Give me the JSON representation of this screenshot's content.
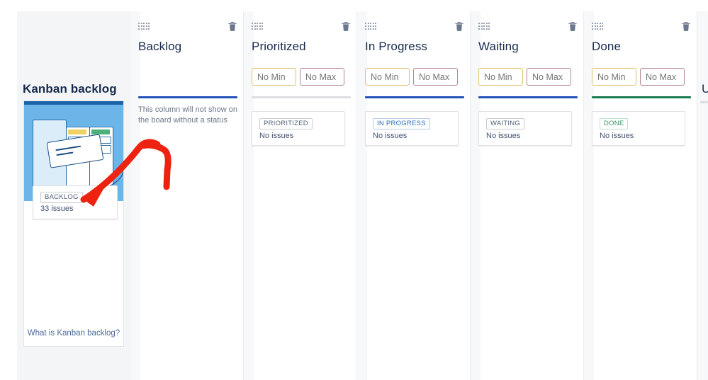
{
  "sidebar": {
    "title": "Kanban backlog",
    "promo": {
      "status_badge": "BACKLOG",
      "status_count": "33 issues",
      "link_label": "What is Kanban backlog?"
    }
  },
  "board": {
    "columns": [
      {
        "title": "Backlog",
        "drag_handle": "drag-handle-icon",
        "delete_icon": "trash-icon",
        "has_wip": false,
        "min_placeholder": "",
        "max_placeholder": "",
        "bar_color": "#2453b8",
        "note": "This column will not show on the board without a status",
        "has_card": false,
        "card_badge": "",
        "card_sub": "",
        "badge_tone": "gray"
      },
      {
        "title": "Prioritized",
        "drag_handle": "drag-handle-icon",
        "delete_icon": "trash-icon",
        "has_wip": true,
        "min_placeholder": "No Min",
        "max_placeholder": "No Max",
        "bar_color": "#dcdde1",
        "note": "",
        "has_card": true,
        "card_badge": "PRIORITIZED",
        "card_sub": "No issues",
        "badge_tone": "gray"
      },
      {
        "title": "In Progress",
        "drag_handle": "drag-handle-icon",
        "delete_icon": "trash-icon",
        "has_wip": true,
        "min_placeholder": "No Min",
        "max_placeholder": "No Max",
        "bar_color": "#2453b8",
        "note": "",
        "has_card": true,
        "card_badge": "IN PROGRESS",
        "card_sub": "No issues",
        "badge_tone": "blue"
      },
      {
        "title": "Waiting",
        "drag_handle": "drag-handle-icon",
        "delete_icon": "trash-icon",
        "has_wip": true,
        "min_placeholder": "No Min",
        "max_placeholder": "No Max",
        "bar_color": "#2453b8",
        "note": "",
        "has_card": true,
        "card_badge": "WAITING",
        "card_sub": "No issues",
        "badge_tone": "gray"
      },
      {
        "title": "Done",
        "drag_handle": "drag-handle-icon",
        "delete_icon": "trash-icon",
        "has_wip": true,
        "min_placeholder": "No Min",
        "max_placeholder": "No Max",
        "bar_color": "#1b7a4f",
        "note": "",
        "has_card": true,
        "card_badge": "DONE",
        "card_sub": "No issues",
        "badge_tone": "green"
      }
    ],
    "partial_column": {
      "visible_text": "U"
    }
  },
  "annotation": {
    "type": "hand-drawn-arrow",
    "color": "#ee2211"
  },
  "colors": {
    "wip_min_border": "#ddc36a",
    "wip_max_border": "#b08792",
    "blue_bar": "#2453b8",
    "green_bar": "#1b7a4f",
    "gray_bar": "#dcdde1",
    "sidebar_bg": "#f4f5f7",
    "illustration_bg": "#6cb5e8"
  }
}
